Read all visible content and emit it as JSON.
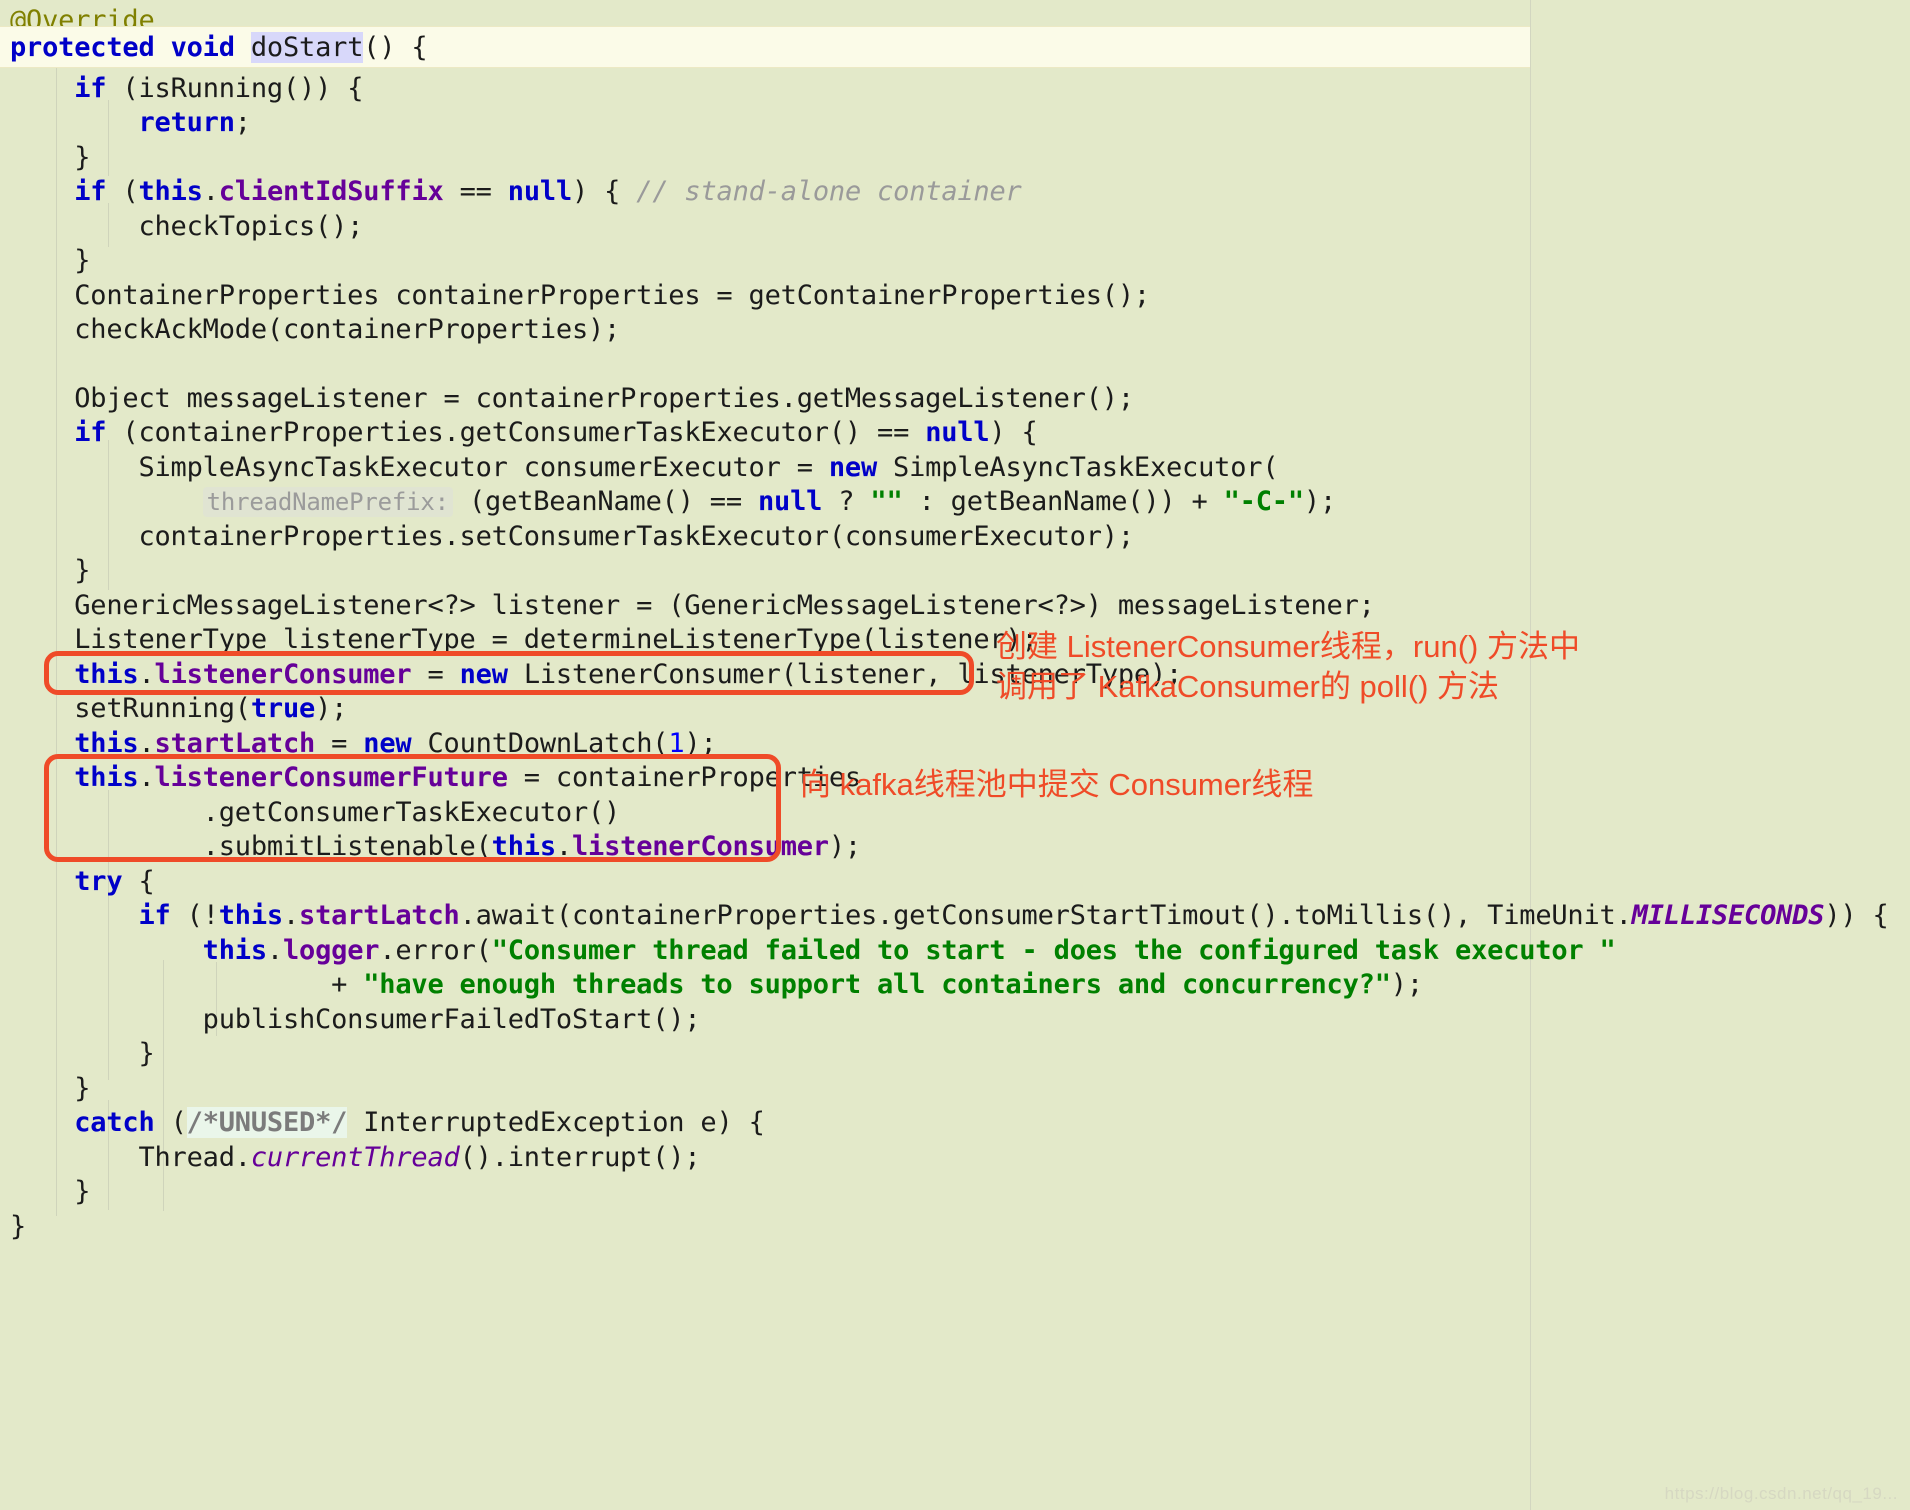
{
  "editor": {
    "language": "java",
    "background_color": "#e3e9c9",
    "caret_line_color": "#fbfbe8",
    "selection_color": "#d8d8fa",
    "annotation_color": "#ef4b28",
    "watermark": "https://blog.csdn.net/qq_19...",
    "lines": [
      {
        "id": "l01",
        "text": "@Override"
      },
      {
        "id": "l02",
        "text": "protected void doStart() {"
      },
      {
        "id": "l03",
        "text": "    if (isRunning()) {"
      },
      {
        "id": "l04",
        "text": "        return;"
      },
      {
        "id": "l05",
        "text": "    }"
      },
      {
        "id": "l06",
        "text": "    if (this.clientIdSuffix == null) { // stand-alone container"
      },
      {
        "id": "l07",
        "text": "        checkTopics();"
      },
      {
        "id": "l08",
        "text": "    }"
      },
      {
        "id": "l09",
        "text": "    ContainerProperties containerProperties = getContainerProperties();"
      },
      {
        "id": "l10",
        "text": "    checkAckMode(containerProperties);"
      },
      {
        "id": "l11",
        "text": ""
      },
      {
        "id": "l12",
        "text": "    Object messageListener = containerProperties.getMessageListener();"
      },
      {
        "id": "l13",
        "text": "    if (containerProperties.getConsumerTaskExecutor() == null) {"
      },
      {
        "id": "l14",
        "text": "        SimpleAsyncTaskExecutor consumerExecutor = new SimpleAsyncTaskExecutor("
      },
      {
        "id": "l15",
        "text": "                threadNamePrefix: (getBeanName() == null ? \"\" : getBeanName()) + \"-C-\");"
      },
      {
        "id": "l16",
        "text": "        containerProperties.setConsumerTaskExecutor(consumerExecutor);"
      },
      {
        "id": "l17",
        "text": "    }"
      },
      {
        "id": "l18",
        "text": "    GenericMessageListener<?> listener = (GenericMessageListener<?>) messageListener;"
      },
      {
        "id": "l19",
        "text": "    ListenerType listenerType = determineListenerType(listener);"
      },
      {
        "id": "l20",
        "text": "    this.listenerConsumer = new ListenerConsumer(listener, listenerType);"
      },
      {
        "id": "l21",
        "text": "    setRunning(true);"
      },
      {
        "id": "l22",
        "text": "    this.startLatch = new CountDownLatch(1);"
      },
      {
        "id": "l23",
        "text": "    this.listenerConsumerFuture = containerProperties"
      },
      {
        "id": "l24",
        "text": "            .getConsumerTaskExecutor()"
      },
      {
        "id": "l25",
        "text": "            .submitListenable(this.listenerConsumer);"
      },
      {
        "id": "l26",
        "text": "    try {"
      },
      {
        "id": "l27",
        "text": "        if (!this.startLatch.await(containerProperties.getConsumerStartTimout().toMillis(), TimeUnit.MILLISECONDS)) {"
      },
      {
        "id": "l28",
        "text": "            this.logger.error(\"Consumer thread failed to start - does the configured task executor \""
      },
      {
        "id": "l29",
        "text": "                    + \"have enough threads to support all containers and concurrency?\");"
      },
      {
        "id": "l30",
        "text": "            publishConsumerFailedToStart();"
      },
      {
        "id": "l31",
        "text": "        }"
      },
      {
        "id": "l32",
        "text": "    }"
      },
      {
        "id": "l33",
        "text": "    catch (/*UNUSED*/ InterruptedException e) {"
      },
      {
        "id": "l34",
        "text": "        Thread.currentThread().interrupt();"
      },
      {
        "id": "l35",
        "text": "    }"
      },
      {
        "id": "l36",
        "text": "}"
      }
    ],
    "parameter_hint": "threadNamePrefix:",
    "unused_marker": "/*UNUSED*/",
    "selected_token": "doStart"
  },
  "annotations": [
    {
      "id": "note1",
      "line1": "创建 ListenerConsumer线程，run() 方法中",
      "line2": "调用了 KafkaConsumer的 poll() 方法",
      "target_line_id": "l20"
    },
    {
      "id": "note2",
      "line1": "向 kafka线程池中提交 Consumer线程",
      "line2": "",
      "target_line_id": "l23"
    }
  ]
}
